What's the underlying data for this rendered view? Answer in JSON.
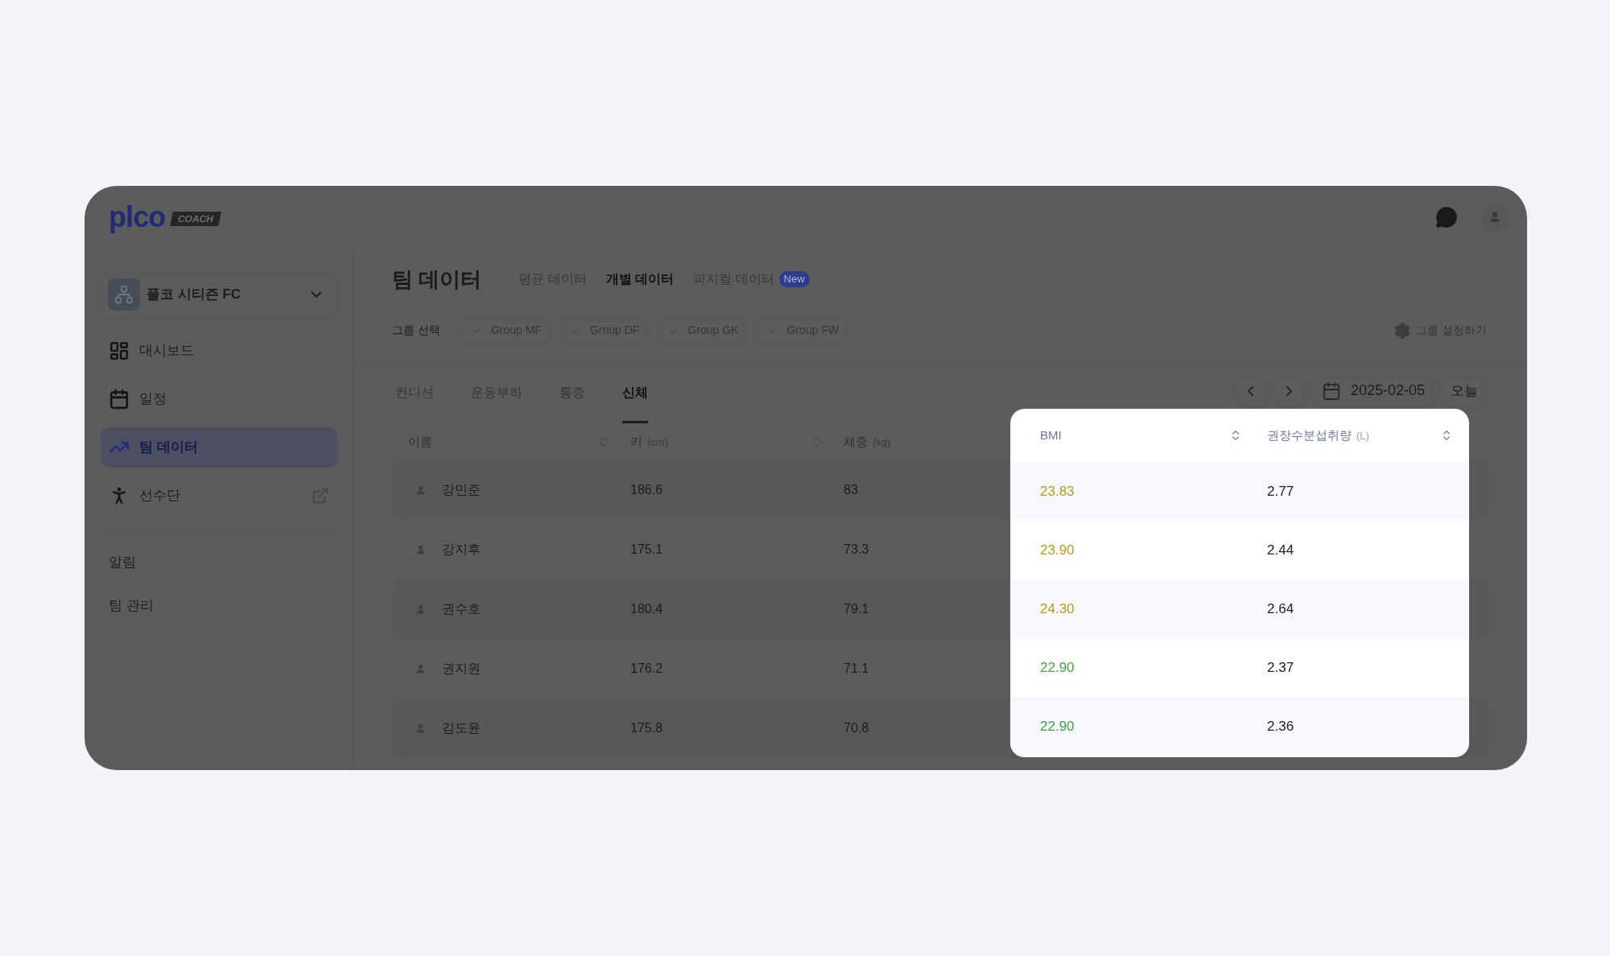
{
  "header": {
    "logo": "plco",
    "logo_badge": "COACH"
  },
  "team_selector": {
    "name": "플코 시티즌 FC"
  },
  "sidebar": {
    "items": [
      {
        "label": "대시보드",
        "selected": false,
        "external": false
      },
      {
        "label": "일정",
        "selected": false,
        "external": false
      },
      {
        "label": "팀 데이터",
        "selected": true,
        "external": false
      },
      {
        "label": "선수단",
        "selected": false,
        "external": true
      }
    ],
    "secondary": [
      {
        "label": "알림"
      },
      {
        "label": "팀 관리"
      }
    ]
  },
  "page": {
    "title": "팀 데이터",
    "tabs": [
      {
        "label": "평균 데이터",
        "selected": false
      },
      {
        "label": "개별 데이터",
        "selected": true
      },
      {
        "label": "피지컬 데이터",
        "selected": false,
        "badge": "New"
      }
    ]
  },
  "groups": {
    "label": "그룹 선택",
    "chips": [
      {
        "label": "Group MF"
      },
      {
        "label": "Group DF"
      },
      {
        "label": "Group GK"
      },
      {
        "label": "Group FW"
      }
    ],
    "settings": "그룹 설정하기"
  },
  "subtabs": [
    {
      "label": "컨디션",
      "selected": false
    },
    {
      "label": "운동부하",
      "selected": false
    },
    {
      "label": "통증",
      "selected": false
    },
    {
      "label": "신체",
      "selected": true
    }
  ],
  "date_nav": {
    "date": "2025-02-05",
    "today": "오늘"
  },
  "table": {
    "columns": [
      {
        "label": "이름",
        "sortable": true,
        "spotlight": false
      },
      {
        "label": "키",
        "unit": "(cm)",
        "sortable": true,
        "spotlight": false
      },
      {
        "label": "체중",
        "unit": "(kg)",
        "sortable": false,
        "spotlight": false
      },
      {
        "label": "BMI",
        "sortable": true,
        "spotlight": true
      },
      {
        "label": "권장수분섭취량",
        "unit": "(L)",
        "sortable": true,
        "spotlight": true
      }
    ],
    "rows": [
      {
        "cells": [
          {
            "text": "강민준"
          },
          {
            "text": "186.6"
          },
          {
            "text": "83"
          },
          {
            "text": "23.83",
            "color": "#b59a1a"
          },
          {
            "text": "2.77"
          }
        ]
      },
      {
        "cells": [
          {
            "text": "강지후"
          },
          {
            "text": "175.1"
          },
          {
            "text": "73.3"
          },
          {
            "text": "23.90",
            "color": "#b59a1a"
          },
          {
            "text": "2.44"
          }
        ]
      },
      {
        "cells": [
          {
            "text": "권수호"
          },
          {
            "text": "180.4"
          },
          {
            "text": "79.1"
          },
          {
            "text": "24.30",
            "color": "#b59a1a"
          },
          {
            "text": "2.64"
          }
        ]
      },
      {
        "cells": [
          {
            "text": "권지원"
          },
          {
            "text": "176.2"
          },
          {
            "text": "71.1"
          },
          {
            "text": "22.90",
            "color": "#3aa53a"
          },
          {
            "text": "2.37"
          }
        ]
      },
      {
        "cells": [
          {
            "text": "김도윤"
          },
          {
            "text": "175.8"
          },
          {
            "text": "70.8"
          },
          {
            "text": "22.90",
            "color": "#3aa53a"
          },
          {
            "text": "2.36"
          }
        ]
      }
    ]
  }
}
